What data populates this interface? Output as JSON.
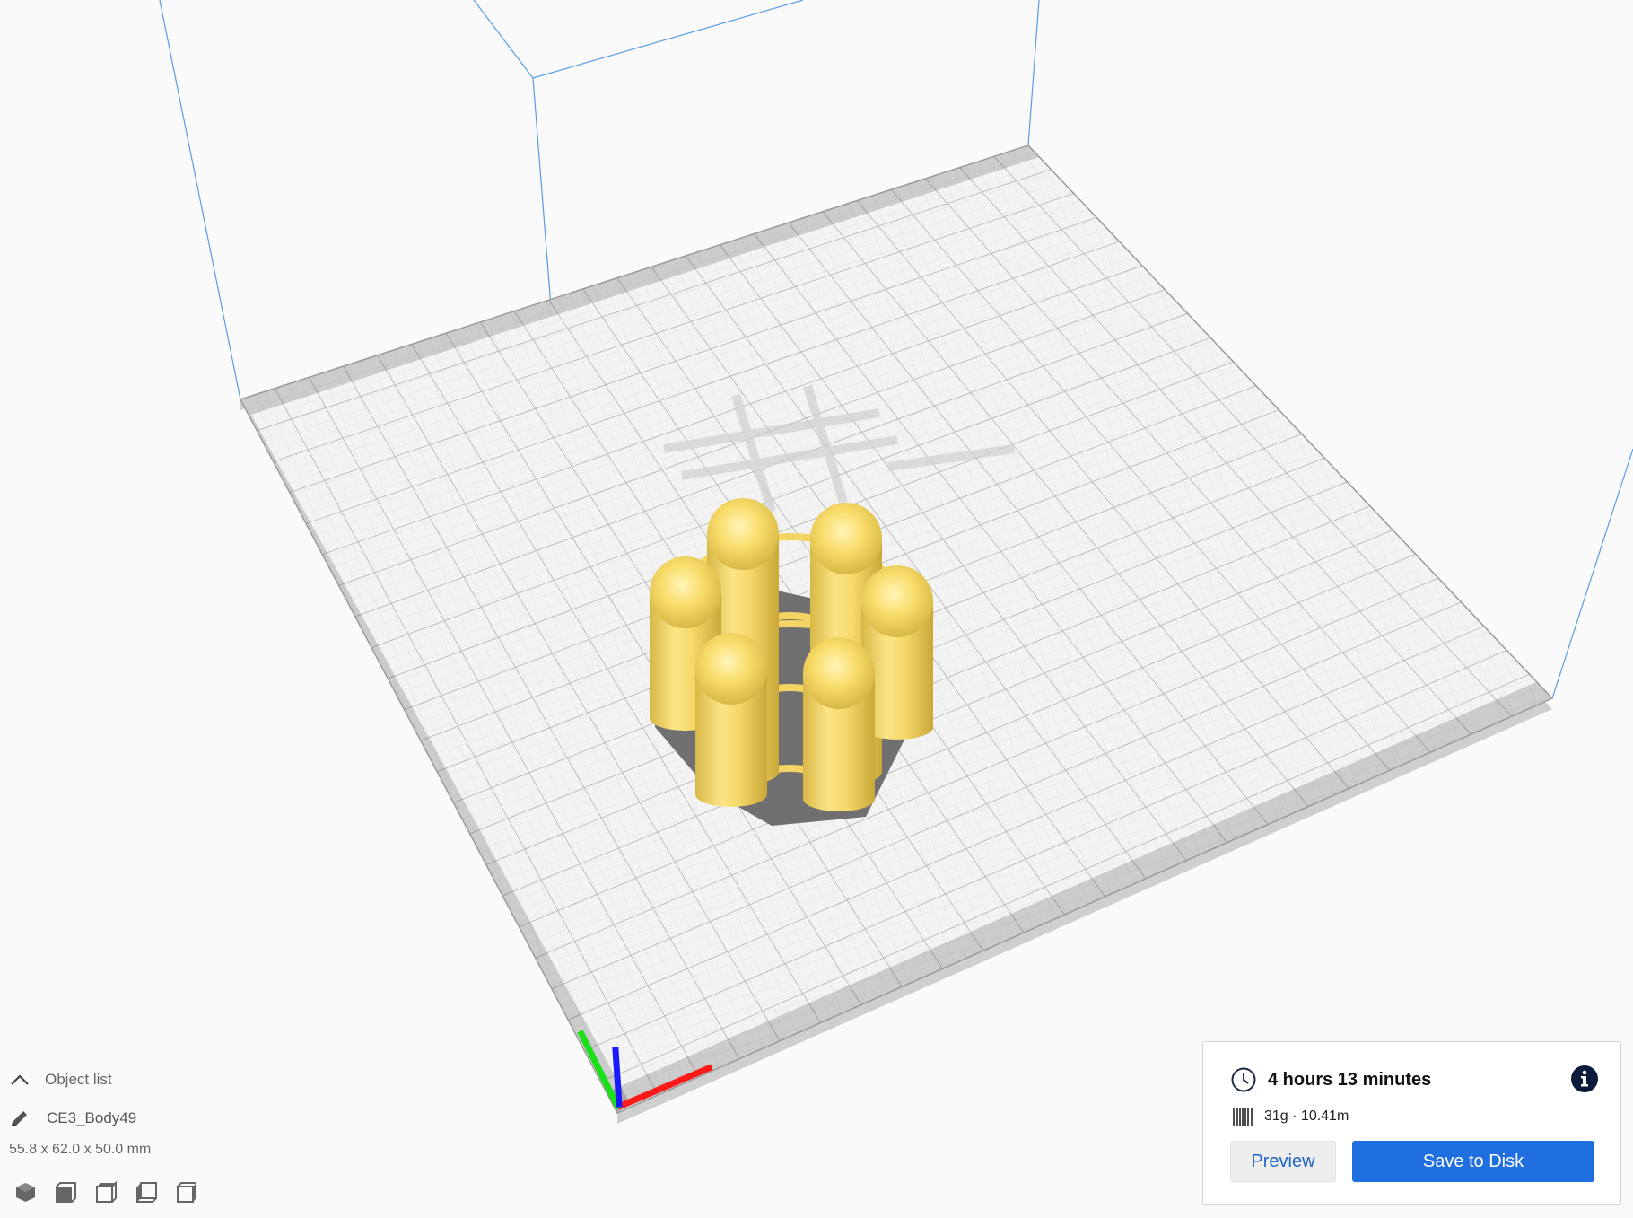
{
  "object_list": {
    "header_label": "Object list",
    "object_name": "CE3_Body49",
    "dimensions": "55.8 x 62.0 x 50.0 mm",
    "view_buttons": [
      "3d-view",
      "front-view",
      "top-view",
      "left-view",
      "right-view"
    ]
  },
  "print_summary": {
    "time": "4 hours 13 minutes",
    "material": "31g · 10.41m",
    "preview_label": "Preview",
    "save_label": "Save to Disk"
  },
  "colors": {
    "model": "#f6d86a",
    "accent": "#1f6fe0",
    "axis_x": "#ff1a1a",
    "axis_y": "#19e019",
    "axis_z": "#1a1aff"
  },
  "icons": [
    "chevron-up-icon",
    "pencil-icon",
    "clock-icon",
    "info-icon",
    "spool-icon"
  ]
}
